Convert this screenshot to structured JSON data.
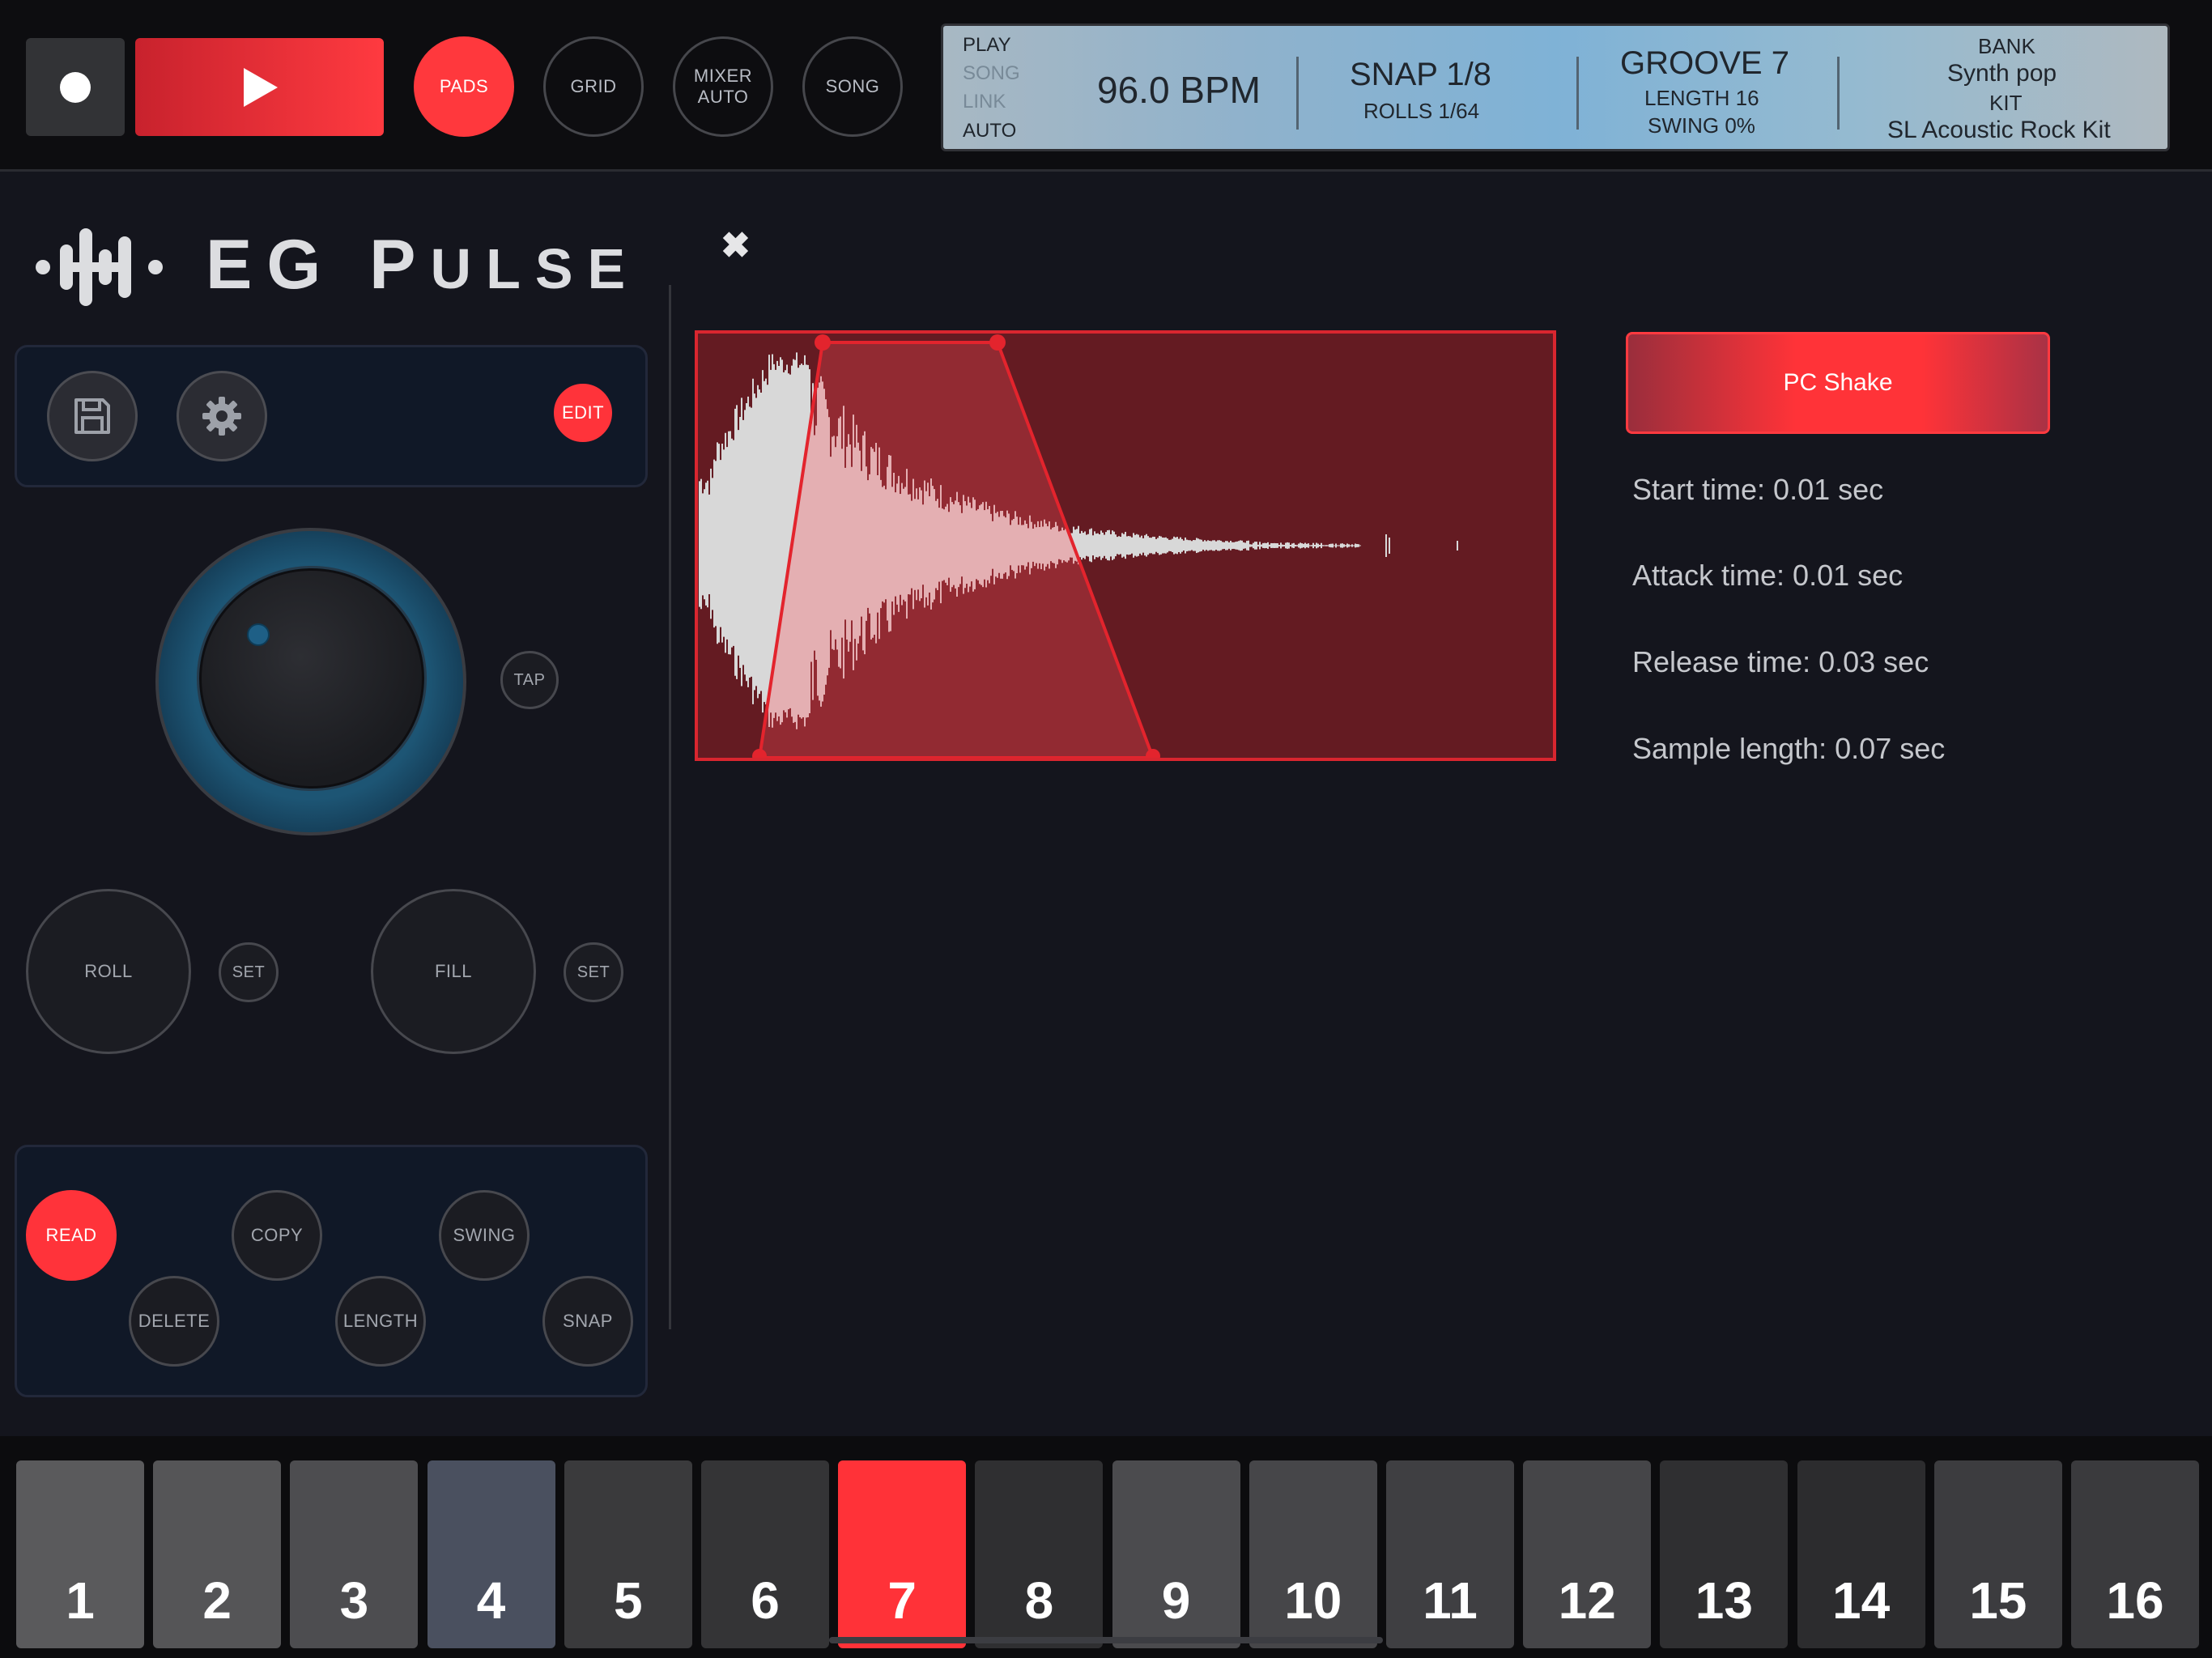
{
  "transport": {
    "record_label": "",
    "play_label": ""
  },
  "modes": {
    "pads": "PADS",
    "grid": "GRID",
    "mixer_line1": "MIXER",
    "mixer_line2": "AUTO",
    "song": "SONG"
  },
  "lcd": {
    "play": "PLAY",
    "song": "SONG",
    "link": "LINK",
    "auto": "AUTO",
    "bpm": "96.0 BPM",
    "snap": "SNAP 1/8",
    "rolls": "ROLLS 1/64",
    "groove": "GROOVE 7",
    "length": "LENGTH 16",
    "swing": "SWING 0%",
    "bank_label": "BANK",
    "bank_value": "Synth pop",
    "kit_label": "KIT",
    "kit_value": "SL Acoustic Rock Kit"
  },
  "brand": {
    "name_first": "EG",
    "name_second_cap": "P",
    "name_second_rest": "ULSE"
  },
  "panel": {
    "edit": "EDIT",
    "tap": "TAP",
    "roll": "ROLL",
    "set1": "SET",
    "fill": "FILL",
    "set2": "SET",
    "read": "READ",
    "copy": "COPY",
    "swing": "SWING",
    "delete": "DELETE",
    "length": "LENGTH",
    "snap": "SNAP"
  },
  "editor": {
    "close": "✖",
    "sample_name": "PC Shake",
    "start_time": "Start time: 0.01 sec",
    "attack_time": "Attack time: 0.01 sec",
    "release_time": "Release time: 0.03 sec",
    "sample_length": "Sample length: 0.07 sec"
  },
  "pads": [
    {
      "label": "1",
      "color": "#5a5a5c"
    },
    {
      "label": "2",
      "color": "#555557"
    },
    {
      "label": "3",
      "color": "#4d4d50"
    },
    {
      "label": "4",
      "color": "#4a505f"
    },
    {
      "label": "5",
      "color": "#3a3a3c"
    },
    {
      "label": "6",
      "color": "#343436"
    },
    {
      "label": "7",
      "color": "#ff3238"
    },
    {
      "label": "8",
      "color": "#2f2f31"
    },
    {
      "label": "9",
      "color": "#4b4b4e"
    },
    {
      "label": "10",
      "color": "#464649"
    },
    {
      "label": "11",
      "color": "#3f3f42"
    },
    {
      "label": "12",
      "color": "#454548"
    },
    {
      "label": "13",
      "color": "#2f2f31"
    },
    {
      "label": "14",
      "color": "#2c2c2e"
    },
    {
      "label": "15",
      "color": "#3c3c3f"
    },
    {
      "label": "16",
      "color": "#3a3a3d"
    }
  ],
  "colors": {
    "accent": "#ff383d",
    "knob_ring": "#1d5574"
  }
}
